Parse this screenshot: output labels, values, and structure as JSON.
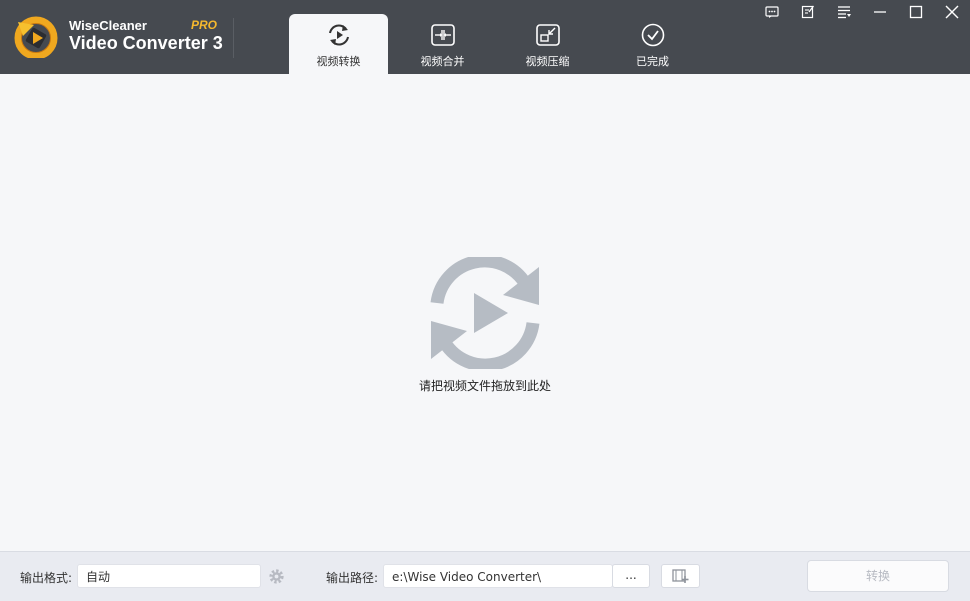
{
  "app": {
    "brand_top": "WiseCleaner",
    "brand_bottom": "Video Converter 3",
    "edition": "PRO"
  },
  "tabs": [
    {
      "label": "视频转换",
      "icon": "convert-icon",
      "active": true
    },
    {
      "label": "视频合并",
      "icon": "merge-icon",
      "active": false
    },
    {
      "label": "视频压缩",
      "icon": "compress-icon",
      "active": false
    },
    {
      "label": "已完成",
      "icon": "check-circle-icon",
      "active": false
    }
  ],
  "window_controls": [
    "feedback-icon",
    "notes-icon",
    "menu-icon",
    "minimize-icon",
    "maximize-icon",
    "close-icon"
  ],
  "main": {
    "drop_hint": "请把视频文件拖放到此处",
    "hero_icon": "convert-play-icon"
  },
  "footer": {
    "format_label": "输出格式:",
    "format_value": "自动",
    "path_label": "输出路径:",
    "path_value": "e:\\Wise Video Converter\\",
    "browse_label": "...",
    "convert_label": "转换"
  },
  "colors": {
    "titlebar": "#464a50",
    "accent": "#f5b82e",
    "hero_icon": "#b6bcc4",
    "background": "#f6f7f9"
  }
}
